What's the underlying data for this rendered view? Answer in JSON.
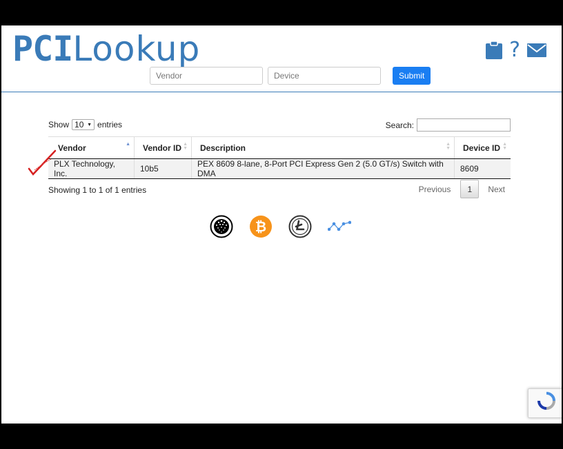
{
  "header": {
    "logo_pci": "PCI",
    "logo_rest": "Lookup",
    "help_glyph": "?",
    "icons": [
      "clipboard-icon",
      "help-icon",
      "envelope-icon"
    ]
  },
  "search": {
    "vendor_placeholder": "Vendor",
    "device_placeholder": "Device",
    "submit_label": "Submit"
  },
  "table_controls": {
    "show_label": "Show",
    "entries_value": "10",
    "entries_label": "entries",
    "search_label": "Search:"
  },
  "table": {
    "columns": [
      "Vendor",
      "Vendor ID",
      "Description",
      "Device ID"
    ],
    "rows": [
      [
        "PLX Technology, Inc.",
        "10b5",
        "PEX 8609 8-lane, 8-Port PCI Express Gen 2 (5.0 GT/s) Switch with DMA",
        "8609"
      ]
    ]
  },
  "footer_table": {
    "info": "Showing 1 to 1 of 1 entries",
    "previous": "Previous",
    "page": "1",
    "next": "Next"
  },
  "crypto_icons": [
    "iota-icon",
    "bitcoin-icon",
    "litecoin-icon",
    "nano-icon"
  ],
  "colors": {
    "brand": "#3a7bb8",
    "submit": "#1a7ef2",
    "bitcoin": "#f7931a",
    "nano": "#4a90e2"
  }
}
